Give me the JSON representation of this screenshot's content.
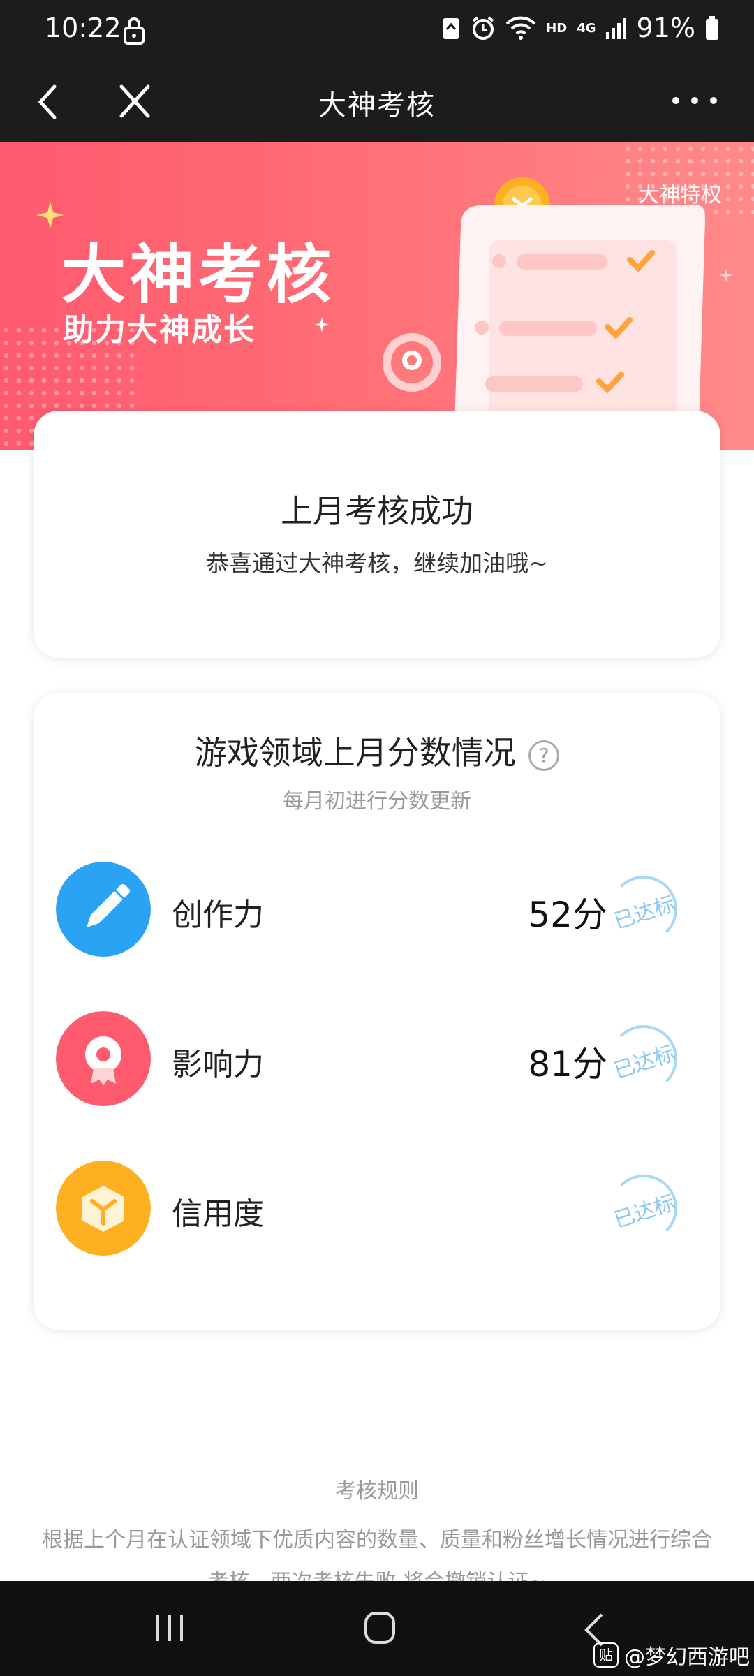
{
  "status_bar": {
    "time": "10:22",
    "network": "HD",
    "signal": "4G",
    "battery": "91%"
  },
  "nav": {
    "title": "大神考核"
  },
  "banner": {
    "title": "大神考核",
    "subtitle": "助力大神成长",
    "privilege": "大神特权",
    "accent_color": "#ff5a6e"
  },
  "result_card": {
    "title": "上月考核成功",
    "subtitle": "恭喜通过大神考核，继续加油哦~"
  },
  "score_card": {
    "title": "游戏领域上月分数情况",
    "help_symbol": "?",
    "subtitle": "每月初进行分数更新",
    "rows": [
      {
        "label": "创作力",
        "score": "52分",
        "status": "已达标",
        "icon": "pencil-icon",
        "color": "#2aa3f5"
      },
      {
        "label": "影响力",
        "score": "81分",
        "status": "已达标",
        "icon": "medal-icon",
        "color": "#ff5a6e"
      },
      {
        "label": "信用度",
        "score": "",
        "status": "已达标",
        "icon": "cube-icon",
        "color": "#ffb020"
      }
    ]
  },
  "rules": {
    "title": "考核规则",
    "text": "根据上个月在认证领域下优质内容的数量、质量和粉丝增长情况进行综合考核，两次考核失败,将会撤销认证~"
  },
  "watermark": {
    "badge": "贴",
    "text": "@梦幻西游吧"
  }
}
